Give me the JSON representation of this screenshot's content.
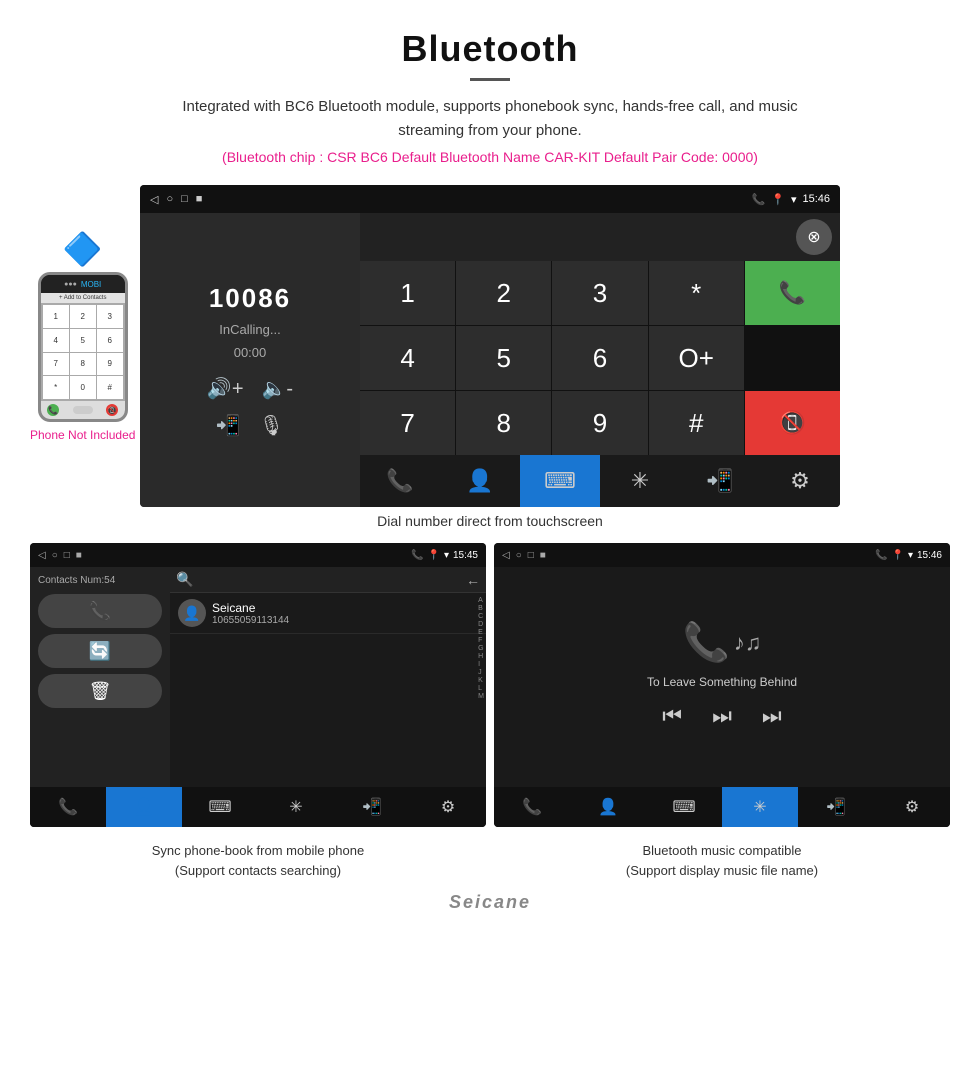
{
  "header": {
    "title": "Bluetooth",
    "description": "Integrated with BC6 Bluetooth module, supports phonebook sync, hands-free call, and music streaming from your phone.",
    "info": "(Bluetooth chip : CSR BC6    Default Bluetooth Name CAR-KIT    Default Pair Code: 0000)"
  },
  "dial_screen": {
    "status_bar": {
      "time": "15:46",
      "icons_left": [
        "◁",
        "○",
        "□",
        "■▪"
      ]
    },
    "number": "10086",
    "status": "InCalling...",
    "timer": "00:00",
    "keys": [
      "1",
      "2",
      "3",
      "*",
      "4",
      "5",
      "6",
      "0+",
      "7",
      "8",
      "9",
      "#"
    ],
    "call_btn": "📞",
    "end_btn": "📵"
  },
  "caption_main": "Dial number direct from touchscreen",
  "phonebook": {
    "contacts_label": "Contacts Num:54",
    "contact_name": "Seicane",
    "contact_number": "10655059113144",
    "search_placeholder": "",
    "alpha": [
      "A",
      "B",
      "C",
      "D",
      "E",
      "F",
      "G",
      "H",
      "I",
      "J",
      "K",
      "L",
      "M"
    ]
  },
  "music": {
    "track_name": "To Leave Something Behind"
  },
  "caption_left": "Sync phone-book from mobile phone\n(Support contacts searching)",
  "caption_right": "Bluetooth music compatible\n(Support display music file name)",
  "phone_mockup": {
    "label": "Phone Not Included",
    "add_contacts": "+ Add to Contacts",
    "keys": [
      "1",
      "2",
      "3",
      "4",
      "5",
      "6",
      "7",
      "8",
      "9",
      "*",
      "0",
      "#"
    ]
  },
  "watermark": "Seicane"
}
